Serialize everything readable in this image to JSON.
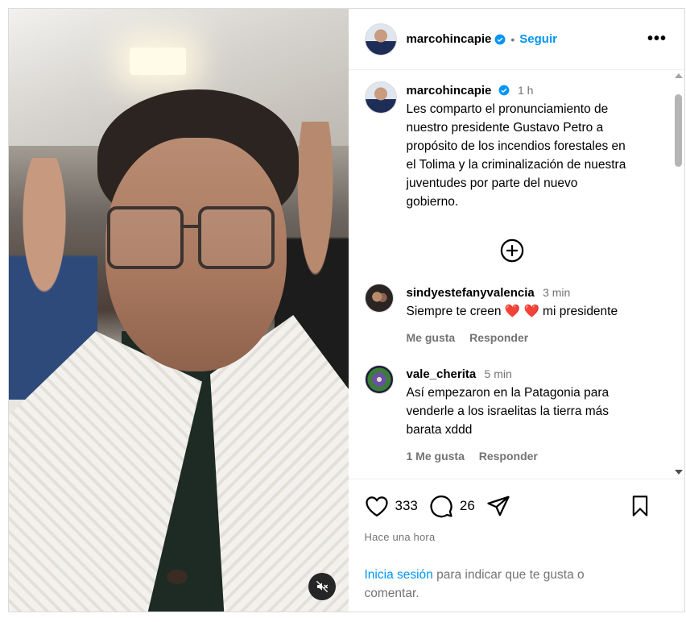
{
  "post": {
    "author": "marcohincapie",
    "follow_label": "Seguir",
    "separator": "•",
    "more_label": "•••",
    "caption_time": "1 h",
    "caption_lines": [
      "Les comparto el pronunciamiento de",
      "nuestro presidente Gustavo Petro a",
      "propósito de los incendios forestales en",
      "el Tolima y la criminalización de nuestra",
      "juventudes por parte del nuevo",
      "gobierno."
    ]
  },
  "comments": [
    {
      "user": "sindyestefanyvalencia",
      "time": "3 min",
      "text_before": "Siempre te creen ",
      "emoji": "❤️ ❤️",
      "text_after": " mi presidente",
      "likes_label": "Me gusta",
      "reply_label": "Responder"
    },
    {
      "user": "vale_cherita",
      "time": "5 min",
      "lines": [
        "Así empezaron en la Patagonia para",
        "venderle a los israelitas la tierra más",
        "barata xddd"
      ],
      "likes_label": "1 Me gusta",
      "reply_label": "Responder"
    }
  ],
  "stats": {
    "likes": "333",
    "comments": "26",
    "posted_ago": "Hace una hora"
  },
  "login_prompt": {
    "link": "Inicia sesión",
    "rest_line1": " para indicar que te gusta o",
    "rest_line2": "comentar."
  },
  "icons": {
    "verified": "verified-badge-icon",
    "more": "more-options-icon",
    "load_more": "plus-circle-icon",
    "like": "heart-icon",
    "comment": "comment-bubble-icon",
    "share": "paper-plane-icon",
    "save": "bookmark-icon",
    "mute": "speaker-muted-icon"
  },
  "colors": {
    "accent": "#0095f6",
    "muted_text": "#737373",
    "heart_emoji": "#ed4956"
  }
}
